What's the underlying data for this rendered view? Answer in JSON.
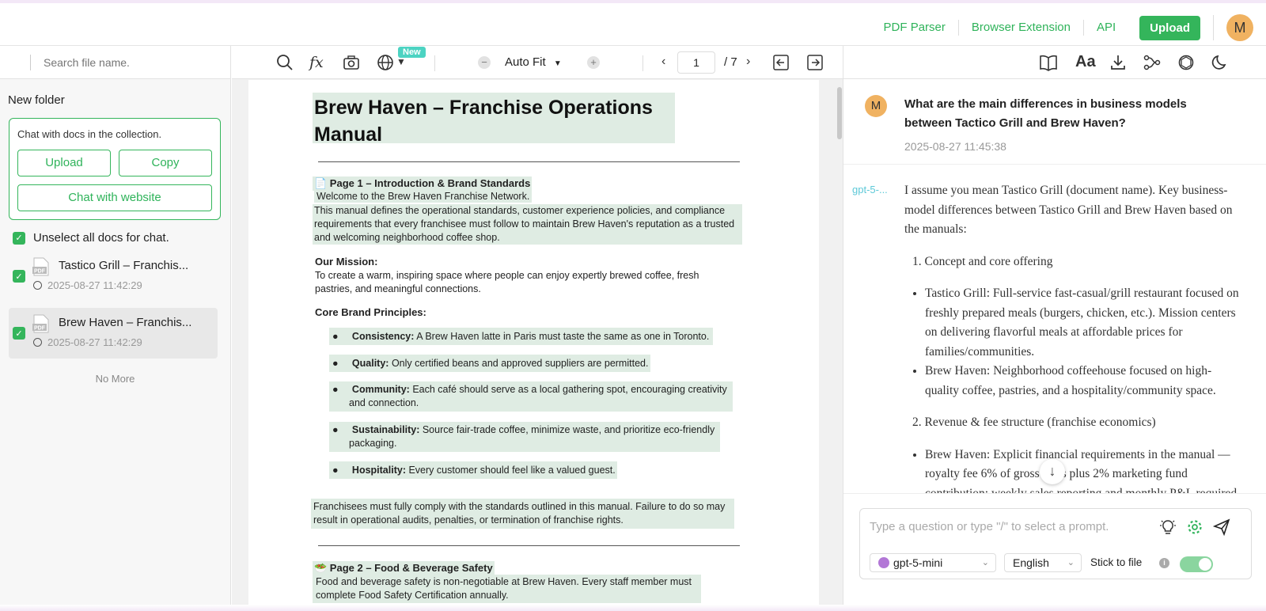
{
  "header": {
    "links": [
      "PDF Parser",
      "Browser Extension",
      "API"
    ],
    "upload_label": "Upload",
    "avatar_initial": "M"
  },
  "sidebar": {
    "search_placeholder": "Search file name.",
    "folder_title": "New folder",
    "collection_desc": "Chat with docs in the collection.",
    "upload_label": "Upload",
    "copy_label": "Copy",
    "chat_website_label": "Chat with website",
    "unselect_label": "Unselect all docs for chat.",
    "docs": [
      {
        "name": "Tastico Grill – Franchis...",
        "date": "2025-08-27 11:42:29"
      },
      {
        "name": "Brew Haven – Franchis...",
        "date": "2025-08-27 11:42:29"
      }
    ],
    "no_more": "No More"
  },
  "viewer": {
    "new_badge": "New",
    "zoom": "Auto Fit",
    "page": "1",
    "total": "/ 7",
    "doc": {
      "title": "Brew Haven – Franchise Operations Manual",
      "p1_heading": "📄 Page 1 – Introduction & Brand Standards",
      "welcome": "Welcome to the Brew Haven Franchise Network.",
      "intro": "This manual defines the operational standards, customer experience policies, and compliance requirements that every franchisee must follow to maintain Brew Haven's reputation as a trusted and welcoming neighborhood coffee shop.",
      "mission_heading": "Our Mission:",
      "mission": "To create a warm, inspiring space where people can enjoy expertly brewed coffee, fresh pastries, and meaningful connections.",
      "principles_heading": "Core Brand Principles:",
      "principles": [
        {
          "term": "Consistency:",
          "text": "A Brew Haven latte in Paris must taste the same as one in Toronto."
        },
        {
          "term": "Quality:",
          "text": "Only certified beans and approved suppliers are permitted."
        },
        {
          "term": "Community:",
          "text": "Each café should serve as a local gathering spot, encouraging creativity and connection."
        },
        {
          "term": "Sustainability:",
          "text": "Source fair-trade coffee, minimize waste, and prioritize eco-friendly packaging."
        },
        {
          "term": "Hospitality:",
          "text": "Every customer should feel like a valued guest."
        }
      ],
      "compliance": "Franchisees must fully comply with the standards outlined in this manual. Failure to do so may result in operational audits, penalties, or termination of franchise rights.",
      "p2_heading": "🥗 Page 2 – Food & Beverage Safety",
      "p2_text": "Food and beverage safety is non-negotiable at Brew Haven. Every staff member must complete Food Safety Certification annually."
    }
  },
  "chat": {
    "question": "What are the main differences in business models between Tactico Grill and Brew Haven?",
    "question_date": "2025-08-27 11:45:38",
    "model_tag": "gpt-5-...",
    "answer_intro": "I assume you mean Tastico Grill (document name). Key business-model differences between Tastico Grill and Brew Haven based on the manuals:",
    "item1": "1. Concept and core offering",
    "item1_bullets": [
      "Tastico Grill: Full-service fast-casual/grill restaurant focused on freshly prepared meals (burgers, chicken, etc.). Mission centers on delivering flavorful meals at affordable prices for families/communities.",
      "Brew Haven: Neighborhood coffeehouse focused on high-quality coffee, pastries, and a hospitality/community space."
    ],
    "item2": "2. Revenue & fee structure (franchise economics)",
    "item2_bullets": [
      "Brew Haven: Explicit financial requirements in the manual — royalty fee 6% of gross sales plus 2% marketing fund contribution; weekly sales reporting and monthly P&L required."
    ],
    "input_placeholder": "Type a question or type \"/\" to select a prompt.",
    "model_select": "gpt-5-mini",
    "language_select": "English",
    "stick_label": "Stick to file"
  },
  "colors": {
    "accent": "#34b55b",
    "highlight": "#dfece3",
    "avatar": "#f0b261",
    "model_tag": "#5ec9d8"
  }
}
